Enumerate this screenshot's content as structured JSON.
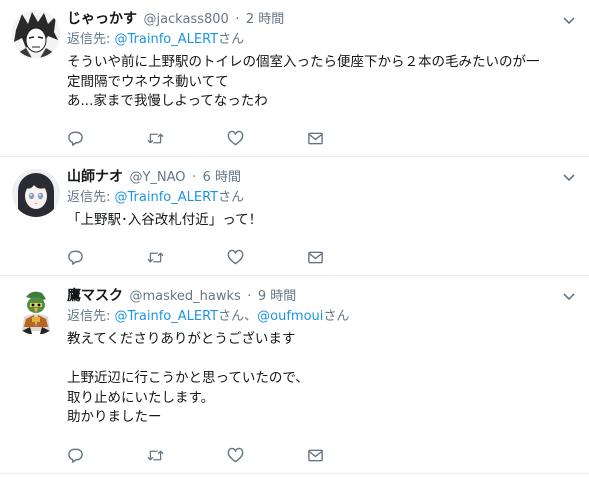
{
  "tweets": [
    {
      "fullname": "じゃっかす",
      "username": "@jackass800",
      "dot": "·",
      "time": "2 時間",
      "reply_prefix": "返信先: ",
      "reply_link": "@Trainfo_ALERT",
      "reply_suffix": "さん",
      "text": "そういや前に上野駅のトイレの個室入ったら便座下から２本の毛みたいのが一\n定間隔でウネウネ動いてて\nあ...家まで我慢しよってなったわ",
      "avatar_icon": "manga-character-avatar"
    },
    {
      "fullname": "山師ナオ",
      "username": "@Y_NAO",
      "dot": "·",
      "time": "6 時間",
      "reply_prefix": "返信先: ",
      "reply_link": "@Trainfo_ALERT",
      "reply_suffix": "さん",
      "text": "「上野駅･入谷改札付近」って！",
      "avatar_icon": "anime-girl-avatar"
    },
    {
      "fullname": "鷹マスク",
      "username": "@masked_hawks",
      "dot": "·",
      "time": "9 時間",
      "reply_prefix": "返信先: ",
      "reply_link": "@Trainfo_ALERT",
      "reply_mid": "さん、",
      "reply_link2": "@oufmoui",
      "reply_suffix": "さん",
      "text": "教えてくださりありがとうございます\n\n上野近辺に行こうかと思っていたので、\n取り止めにいたします。\n助かりましたー",
      "avatar_icon": "hawk-mascot-avatar"
    }
  ],
  "colors": {
    "link": "#1b95e0",
    "secondary": "#657786",
    "divider": "#e6ecf0"
  },
  "icons": [
    "reply-icon",
    "retweet-icon",
    "like-icon",
    "dm-icon",
    "chevron-down-icon"
  ]
}
